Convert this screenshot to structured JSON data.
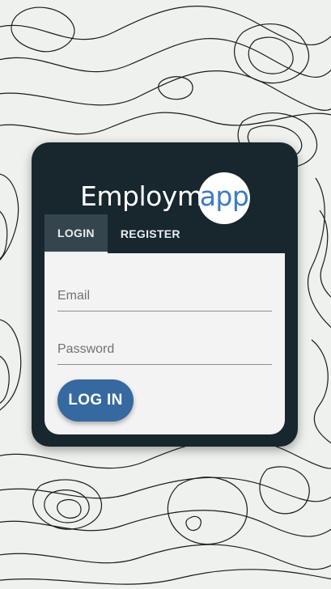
{
  "app": {
    "logo_main": "Employm",
    "logo_accent": "app"
  },
  "tabs": [
    {
      "label": "LOGIN",
      "active": true
    },
    {
      "label": "REGISTER",
      "active": false
    }
  ],
  "form": {
    "email_placeholder": "Email",
    "email_value": "",
    "password_placeholder": "Password",
    "password_value": "",
    "submit_label": "LOG IN"
  },
  "colors": {
    "card_bg": "#18262e",
    "accent": "#3b7bc4",
    "button": "#3569a0",
    "page_bg": "#eef1ed"
  }
}
